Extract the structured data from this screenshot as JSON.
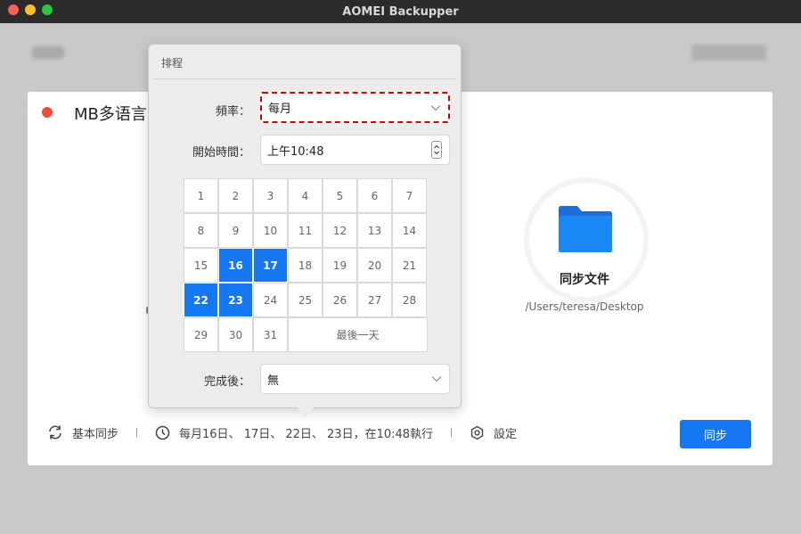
{
  "window": {
    "title": "AOMEI Backupper"
  },
  "task": {
    "name": "MB多语言"
  },
  "destination": {
    "label": "同步文件",
    "path": "/Users/teresa/Desktop"
  },
  "bottom_bar": {
    "sync_mode": "基本同步",
    "schedule_summary": "每月16日、 17日、 22日、 23日，在10:48執行",
    "settings": "設定",
    "sync_button": "同步"
  },
  "popup": {
    "title": "排程",
    "frequency_label": "頻率：",
    "frequency_value": "每月",
    "start_time_label": "開始時間：",
    "start_time_value": "上午10:48",
    "after_label": "完成後：",
    "after_value": "無",
    "calendar": {
      "days": [
        "1",
        "2",
        "3",
        "4",
        "5",
        "6",
        "7",
        "8",
        "9",
        "10",
        "11",
        "12",
        "13",
        "14",
        "15",
        "16",
        "17",
        "18",
        "19",
        "20",
        "21",
        "22",
        "23",
        "24",
        "25",
        "26",
        "27",
        "28",
        "29",
        "30",
        "31"
      ],
      "last_day_label": "最後一天",
      "selected": [
        "16",
        "17",
        "22",
        "23"
      ]
    }
  },
  "colors": {
    "accent": "#1677f2",
    "task_status": "#f24b39",
    "highlight_border": "#d40000"
  }
}
